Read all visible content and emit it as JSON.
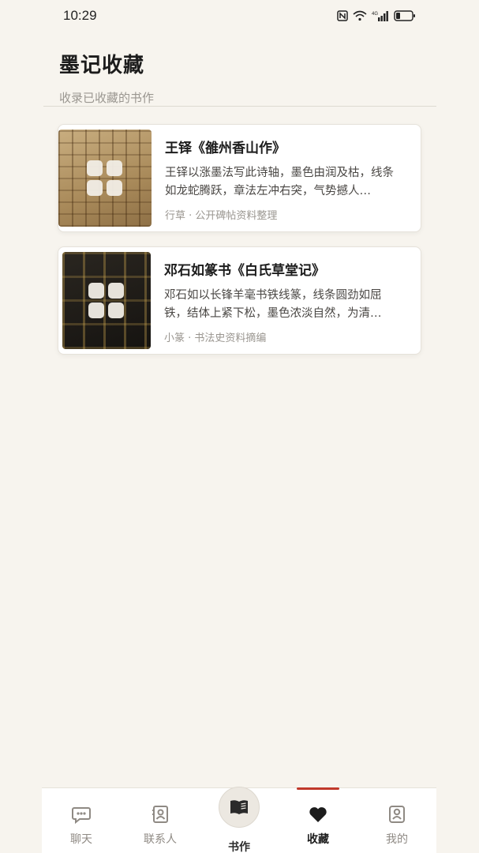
{
  "status_bar": {
    "time": "10:29",
    "icons": [
      "nfc-icon",
      "wifi-icon",
      "signal-4g-icon",
      "battery-icon"
    ],
    "network": "4G"
  },
  "header": {
    "title": "墨记收藏",
    "subtitle": "收录已收藏的书作"
  },
  "collections": [
    {
      "title": "王铎《雒州香山作》",
      "description": "王铎以涨墨法写此诗轴，墨色由润及枯，线条如龙蛇腾跃，章法左冲右突，气势撼人…",
      "meta": "行草 · 公开碑帖资料整理"
    },
    {
      "title": "邓石如篆书《白氏草堂记》",
      "description": "邓石如以长锋羊毫书铁线篆，线条圆劲如屈铁，结体上紧下松，墨色浓淡自然，为清…",
      "meta": "小篆 · 书法史资料摘编"
    }
  ],
  "nav": {
    "items": [
      {
        "label": "聊天",
        "icon": "chat-icon"
      },
      {
        "label": "联系人",
        "icon": "contacts-icon"
      },
      {
        "label": "书作",
        "icon": "book-icon"
      },
      {
        "label": "收藏",
        "icon": "heart-icon"
      },
      {
        "label": "我的",
        "icon": "profile-icon"
      }
    ],
    "active": "收藏"
  },
  "colors": {
    "background": "#f7f4ee",
    "accent": "#c0392b"
  }
}
